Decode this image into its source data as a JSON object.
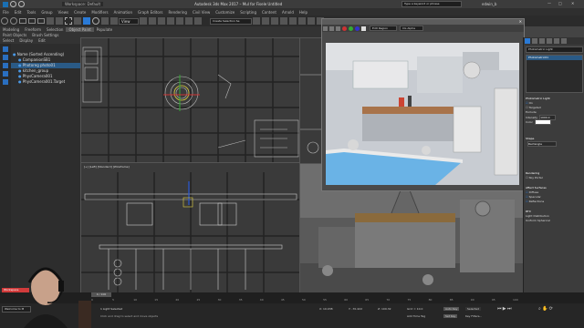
{
  "titlebar": {
    "workspace": "Workspace: Default",
    "title": "Autodesk 3ds Max 2017 – Mul for Fisele   Untitled",
    "search_placeholder": "Type a keyword or phrase",
    "user": "edwin_b"
  },
  "menus": [
    "File",
    "Edit",
    "Tools",
    "Group",
    "Views",
    "Create",
    "Modifiers",
    "Animation",
    "Graph Editors",
    "Rendering",
    "Civil View",
    "Customize",
    "Scripting",
    "Content",
    "Arnold",
    "Help"
  ],
  "ribbon": {
    "tabs": [
      "Modeling",
      "Freeform",
      "Selection",
      "Object Paint",
      "Populate"
    ],
    "sub": [
      "Paint Objects",
      "Brush Settings"
    ]
  },
  "toolbar": {
    "selection_set": "Create Selection Se",
    "view_mode": "View"
  },
  "explorer": {
    "tabs": [
      "Select",
      "Display",
      "Edit"
    ],
    "rows": [
      {
        "label": "Name (Sorted Ascending)",
        "indent": 0
      },
      {
        "label": "CompanionSB1",
        "indent": 1
      },
      {
        "label": "Photoreg photo01",
        "indent": 1,
        "selected": true
      },
      {
        "label": "kitchen_group",
        "indent": 1
      },
      {
        "label": "PhysCamera001",
        "indent": 1
      },
      {
        "label": "PhysCamera001.Target",
        "indent": 1
      }
    ]
  },
  "viewports": {
    "bottom_left_label": "[+] [Left] [Standard] [Wireframe]"
  },
  "frame_window": {
    "area": "Edit Region",
    "title": "CG Alpha"
  },
  "command_panel": {
    "object_name": "Photometric Light",
    "list_items": [
      "Photometric01"
    ],
    "sections": {
      "params_title": "Photometric Light",
      "on": "On",
      "targeted": "Targeted",
      "exclude": "Exclude",
      "intensity_label": "Intensity",
      "intensity_value": "1000.0",
      "color_label": "Color",
      "shape_title": "Shape",
      "shape_value": "Rectangle",
      "rendering": "Rendering",
      "sky_portal": "Sky Portal",
      "affect_surfaces": "Affect Surfaces",
      "diffuse": "Diffuse",
      "specular": "Specular",
      "reflections": "Reflections",
      "light_distribution": "Light Distribution",
      "uniform_spherical": "Uniform Spherical",
      "rtx": "RTX"
    }
  },
  "timeline": {
    "frame": "0 / 100",
    "ticks": [
      "0",
      "5",
      "10",
      "15",
      "20",
      "25",
      "30",
      "35",
      "40",
      "45",
      "50",
      "55",
      "60",
      "65",
      "70",
      "75",
      "80",
      "85",
      "90",
      "95",
      "100"
    ]
  },
  "statusbar": {
    "maxscript": "Welcome to M",
    "status": "1 Light Selected",
    "prompt": "Click and drag to select and move objects",
    "x": "X: 19.938",
    "y": "Y: -70.422",
    "z": "Z: 109.32",
    "grid": "Grid = 10.0",
    "add_time_tag": "Add Time Tag",
    "autokey": "Auto Key",
    "selected": "Selected",
    "set_key": "Set Key",
    "key_filters": "Key Filters..."
  },
  "colors": {
    "accent": "#2a7ad6",
    "ui_dark": "#2b2b2b",
    "ui_mid": "#3c3c3c",
    "selection_blue": "#2a5a86"
  }
}
